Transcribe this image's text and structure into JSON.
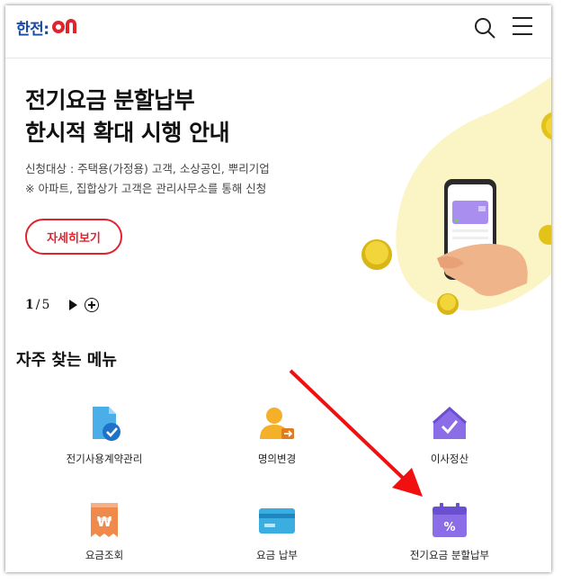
{
  "header": {
    "logo_text": "한전:",
    "logo_on_text": "ON",
    "search_icon": "search-icon",
    "menu_icon": "hamburger-menu-icon"
  },
  "banner": {
    "title_line1": "전기요금 분할납부",
    "title_line2": "한시적 확대 시행 안내",
    "sub_line1": "신청대상 : 주택용(가정용) 고객, 소상공인, 뿌리기업",
    "sub_line2": "※ 아파트, 집합상가 고객은 관리사무소를 통해 신청",
    "detail_button": "자세히보기",
    "pager_current": "1",
    "pager_sep": "/",
    "pager_total": "5",
    "accent_color": "#e0242e"
  },
  "frequent_menu": {
    "title": "자주 찾는 메뉴",
    "items": [
      {
        "label": "전기사용계약관리",
        "icon": "document-check-icon"
      },
      {
        "label": "명의변경",
        "icon": "person-change-icon"
      },
      {
        "label": "이사정산",
        "icon": "house-check-icon"
      },
      {
        "label": "요금조회",
        "icon": "receipt-won-icon"
      },
      {
        "label": "요금 납부",
        "icon": "credit-card-icon"
      },
      {
        "label": "전기요금 분할납부",
        "icon": "calendar-percent-icon"
      }
    ]
  }
}
